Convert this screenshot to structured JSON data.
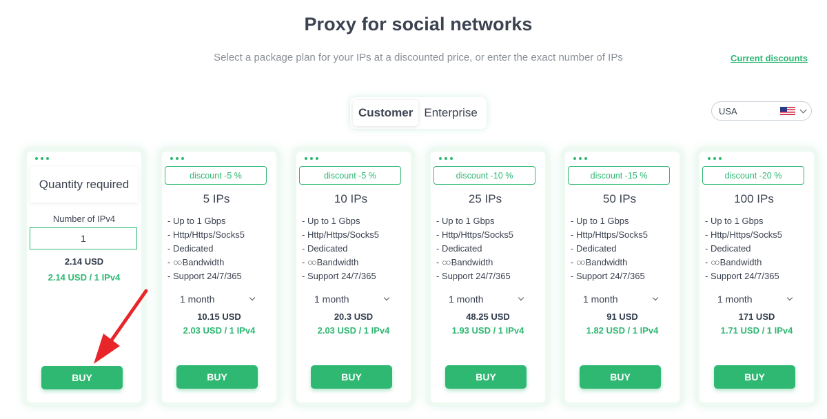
{
  "header": {
    "title": "Proxy for social networks",
    "subtitle": "Select a package plan for your IPs at a discounted price, or enter the exact number of IPs",
    "discounts_link": "Current discounts"
  },
  "tabs": {
    "customer": "Customer",
    "enterprise": "Enterprise",
    "active": "Customer"
  },
  "country_select": {
    "value": "USA",
    "flag": "us-flag-icon"
  },
  "custom_card": {
    "title": "Quantity required",
    "number_label": "Number of IPv4",
    "number_value": "1",
    "total": "2.14 USD",
    "per_ip": "2.14 USD / 1 IPv4",
    "buy_label": "BUY"
  },
  "features": [
    "- Up to 1 Gbps",
    "- Http/Https/Socks5",
    "- Dedicated",
    "Bandwidth",
    "- Support 24/7/365"
  ],
  "feature_bandwidth_prefix": "- ",
  "infinity_symbol": "○○",
  "plans": [
    {
      "discount": "discount -5 %",
      "ips": "5 IPs",
      "period": "1 month",
      "total": "10.15 USD",
      "per_ip": "2.03 USD / 1 IPv4",
      "buy_label": "BUY"
    },
    {
      "discount": "discount -5 %",
      "ips": "10 IPs",
      "period": "1 month",
      "total": "20.3 USD",
      "per_ip": "2.03 USD / 1 IPv4",
      "buy_label": "BUY"
    },
    {
      "discount": "discount -10 %",
      "ips": "25 IPs",
      "period": "1 month",
      "total": "48.25 USD",
      "per_ip": "1.93 USD / 1 IPv4",
      "buy_label": "BUY"
    },
    {
      "discount": "discount -15 %",
      "ips": "50 IPs",
      "period": "1 month",
      "total": "91 USD",
      "per_ip": "1.82 USD / 1 IPv4",
      "buy_label": "BUY"
    },
    {
      "discount": "discount -20 %",
      "ips": "100 IPs",
      "period": "1 month",
      "total": "171 USD",
      "per_ip": "1.71 USD / 1 IPv4",
      "buy_label": "BUY"
    }
  ],
  "colors": {
    "accent": "#2eb872",
    "text": "#3b4250",
    "annotation_arrow": "#e8262a"
  }
}
